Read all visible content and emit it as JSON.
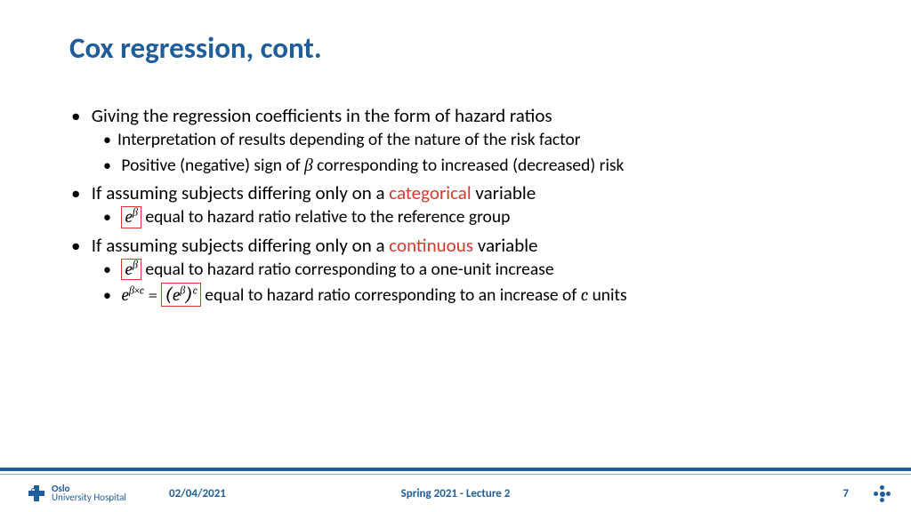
{
  "title": "Cox regression, cont.",
  "b1": {
    "text": "Giving the regression coefficients in the form of hazard ratios",
    "sub1": "Interpretation of results depending of the nature of the risk factor",
    "sub2_a": "Positive (negative) sign of ",
    "sub2_b": " corresponding to increased (decreased) risk"
  },
  "b2": {
    "a": "If assuming subjects differing only on a ",
    "red": "categorical",
    "b": " variable",
    "sub_b": " equal to hazard ratio relative to the reference group"
  },
  "b3": {
    "a": "If assuming subjects differing only on a ",
    "red": "continuous",
    "b": " variable",
    "sub1_b": " equal to hazard ratio corresponding to a one-unit increase",
    "sub2_b": " equal to hazard ratio corresponding to an increase of ",
    "sub2_c": " units"
  },
  "math": {
    "e": "e",
    "beta": "β",
    "beta_c": "β×c",
    "eq": " = ",
    "c": "c"
  },
  "footer": {
    "org1": "Oslo",
    "org2": "University Hospital",
    "date": "02/04/2021",
    "course": "Spring 2021 - Lecture 2",
    "page": "7"
  }
}
